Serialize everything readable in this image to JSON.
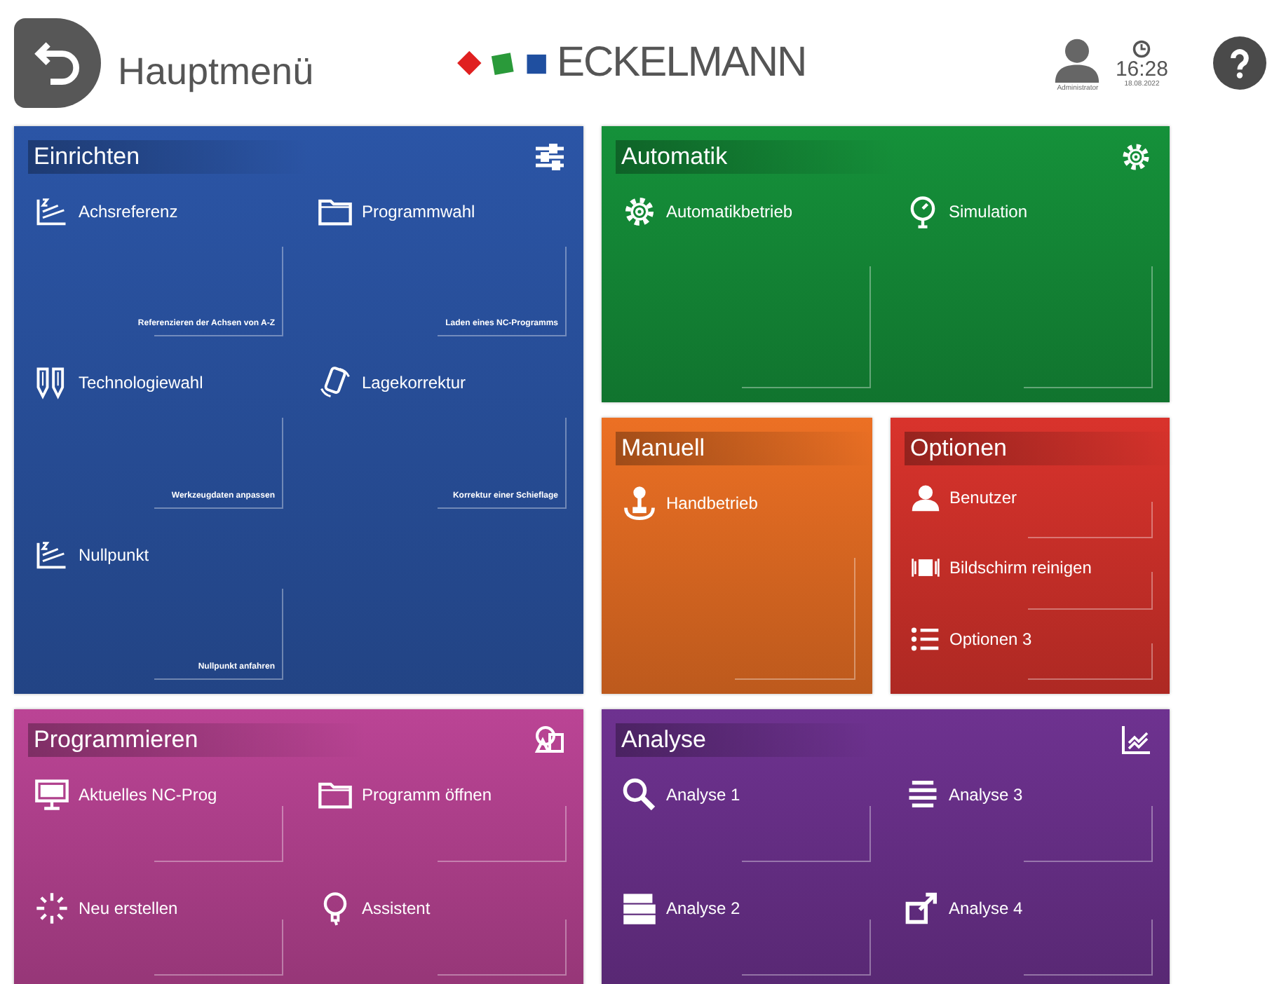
{
  "header": {
    "title": "Hauptmenü",
    "logo": "ECKELMANN",
    "user": "Administrator",
    "time": "16:28",
    "date": "18.08.2022"
  },
  "tiles": [
    {
      "title": "Einrichten",
      "color": "#2b55a6",
      "items": [
        {
          "label": "Achsreferenz",
          "note": "Referenzieren der Achsen von A-Z"
        },
        {
          "label": "Programmwahl",
          "note": "Laden eines NC-Programms"
        },
        {
          "label": "Technologiewahl",
          "note": "Werkzeugdaten anpassen"
        },
        {
          "label": "Lagekorrektur",
          "note": "Korrektur einer Schieflage"
        },
        {
          "label": "Nullpunkt",
          "note": "Nullpunkt anfahren"
        }
      ]
    },
    {
      "title": "Automatik",
      "color": "#15913a",
      "items": [
        {
          "label": "Automatikbetrieb"
        },
        {
          "label": "Simulation"
        }
      ]
    },
    {
      "title": "Manuell",
      "color": "#ec7024",
      "items": [
        {
          "label": "Handbetrieb"
        }
      ]
    },
    {
      "title": "Optionen",
      "color": "#d9332c",
      "items": [
        {
          "label": "Benutzer"
        },
        {
          "label": "Bildschirm reinigen"
        },
        {
          "label": "Optionen 3"
        }
      ]
    },
    {
      "title": "Programmieren",
      "color": "#bb4495",
      "items": [
        {
          "label": "Aktuelles NC-Prog"
        },
        {
          "label": "Programm öffnen"
        },
        {
          "label": "Neu erstellen"
        },
        {
          "label": "Assistent"
        }
      ]
    },
    {
      "title": "Analyse",
      "color": "#6e3290",
      "items": [
        {
          "label": "Analyse 1"
        },
        {
          "label": "Analyse 3"
        },
        {
          "label": "Analyse 2"
        },
        {
          "label": "Analyse 4"
        }
      ]
    }
  ]
}
